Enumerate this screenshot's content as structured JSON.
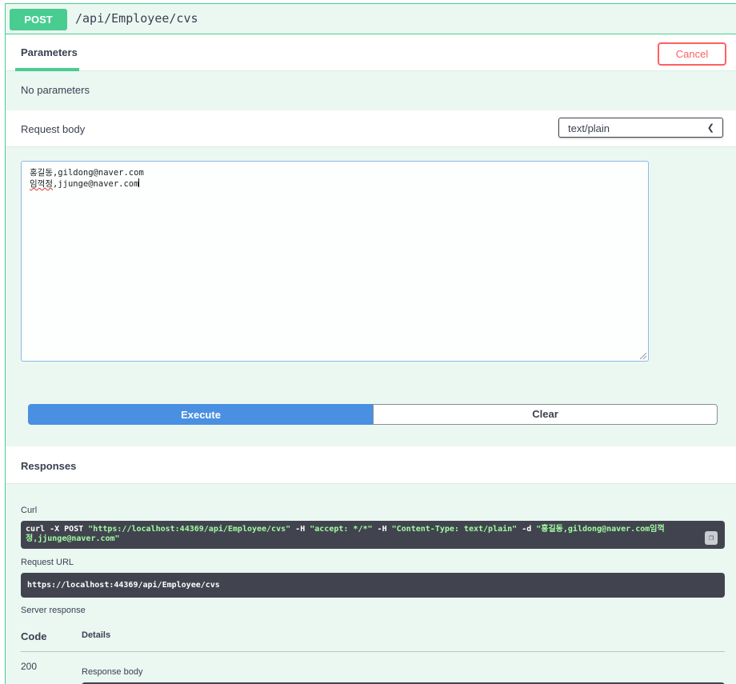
{
  "summary": {
    "method": "POST",
    "path": "/api/Employee/cvs"
  },
  "parameters": {
    "tab_label": "Parameters",
    "cancel_label": "Cancel",
    "empty_text": "No parameters"
  },
  "request_body": {
    "label": "Request body",
    "content_type": "text/plain",
    "lines": [
      {
        "name": "홍길동",
        "rest": ",gildong@naver.com"
      },
      {
        "name": "임꺽정",
        "rest": ",jjunge@naver.com"
      }
    ]
  },
  "actions": {
    "execute_label": "Execute",
    "clear_label": "Clear"
  },
  "responses": {
    "title": "Responses",
    "curl_label": "Curl",
    "curl": {
      "p1": "curl -X POST ",
      "url": "\"https://localhost:44369/api/Employee/cvs\"",
      "p2": " -H ",
      "accept": " \"accept: */*\"",
      "p3": " -H ",
      "ctype": " \"Content-Type: text/plain\"",
      "p4": " -d ",
      "body1": "\"홍길동,gildong@naver.com임꺽",
      "body2": "정,jjunge@naver.com\""
    },
    "request_url_label": "Request URL",
    "request_url": "https://localhost:44369/api/Employee/cvs",
    "server_response_label": "Server response",
    "code_header": "Code",
    "details_header": "Details",
    "code": "200",
    "response_body_label": "Response body"
  }
}
